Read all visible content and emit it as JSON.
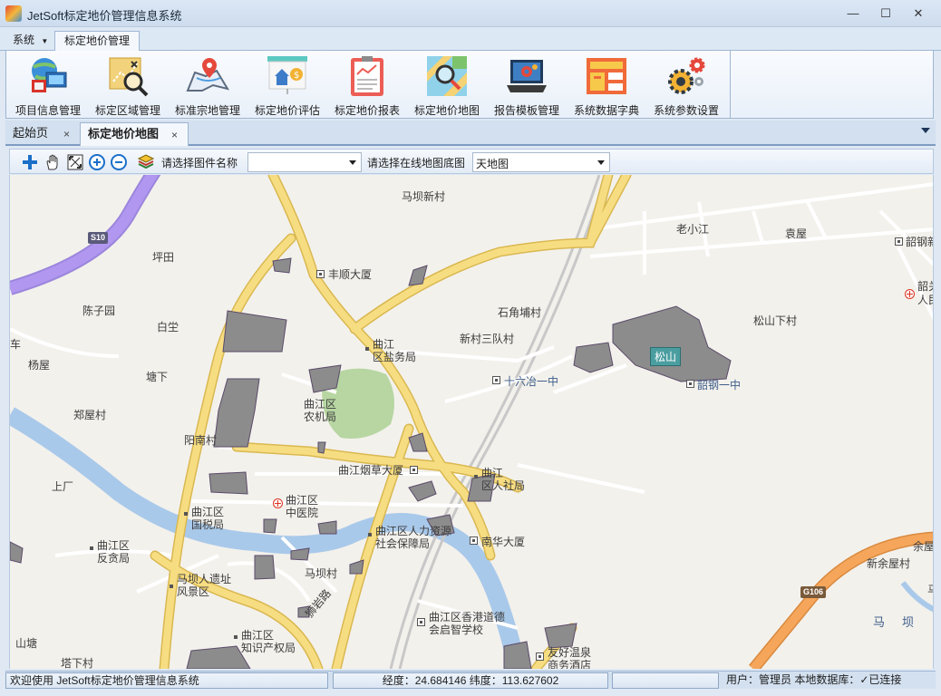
{
  "window": {
    "title": "JetSoft标定地价管理信息系统",
    "controls": [
      "—",
      "☐",
      "✕"
    ]
  },
  "ribbon": {
    "tabs": [
      {
        "label": "系统",
        "has_dropdown": true
      },
      {
        "label": "标定地价管理",
        "active": true
      }
    ],
    "buttons": [
      {
        "label": "项目信息管理",
        "icon": "globe-network-icon"
      },
      {
        "label": "标定区域管理",
        "icon": "map-search-icon"
      },
      {
        "label": "标准宗地管理",
        "icon": "map-pin-icon"
      },
      {
        "label": "标定地价评估",
        "icon": "house-price-icon"
      },
      {
        "label": "标定地价报表",
        "icon": "report-chart-icon"
      },
      {
        "label": "标定地价地图",
        "icon": "map-magnifier-icon"
      },
      {
        "label": "报告模板管理",
        "icon": "laptop-gear-icon"
      },
      {
        "label": "系统数据字典",
        "icon": "data-dictionary-icon"
      },
      {
        "label": "系统参数设置",
        "icon": "gears-icon"
      }
    ]
  },
  "doc_tabs": [
    {
      "label": "起始页",
      "close": "×"
    },
    {
      "label": "标定地价地图",
      "close": "×",
      "active": true
    }
  ],
  "map_toolbar": {
    "tools": [
      "zoom-in-icon",
      "pan-hand-icon",
      "full-extent-icon",
      "zoom-in-circle-icon",
      "zoom-out-circle-icon",
      "layers-icon"
    ],
    "layer_label": "请选择图件名称",
    "layer_value": "",
    "basemap_label": "请选择在线地图底图",
    "basemap_value": "天地图"
  },
  "map": {
    "labels": {
      "mabanxincun": "马坝新村",
      "laoxiaojiang": "老小江",
      "yuanwu": "袁屋",
      "shaogangxin": "韶钢新",
      "pingtian": "坪田",
      "fengshun": "丰顺大厦",
      "shaoguang": "韶关",
      "renyi": "人民",
      "chenziyuan": "陈子园",
      "baitang": "白坣",
      "shijiaopucun": "石角埔村",
      "songshanxiacun": "松山下村",
      "che": "车",
      "qujiang_yanwu": "曲江\n区盐务局",
      "xincunsandui": "新村三队村",
      "songshan": "松山",
      "yangwu": "杨屋",
      "tangxia": "塘下",
      "shiliuye": "十六冶一中",
      "shaogangyizhong": "韶钢一中",
      "qujiang_nongji": "曲江区\n农机局",
      "zhengwucun": "郑屋村",
      "yangnancun": "阳南村",
      "yancao": "曲江烟草大厦",
      "renshe": "曲江\n区人社局",
      "shangchang": "上厂",
      "zhongyiyuan": "曲江区\n中医院",
      "guoshui": "曲江区\n国税局",
      "renli": "曲江区人力资源\n社会保障局",
      "nanhua": "南华大厦",
      "fanzui": "曲江区\n反贪局",
      "yuwu": "余屋",
      "yuwucun": "新余屋村",
      "maba_ruins": "马坝人遗址\n风景区",
      "mabacun": "马坝村",
      "shandong": "山塘",
      "xiangang": "曲江区香港道德\n会启智学校",
      "zhishi": "曲江区\n知识产权局",
      "youhao": "友好温泉\n商务酒店",
      "taxia": "塔下村",
      "ma": "马",
      "ba": "坝",
      "road_name": "狮岩路"
    },
    "road_shields": [
      "S10",
      "G106"
    ]
  },
  "status": {
    "welcome": "欢迎使用 JetSoft标定地价管理信息系统",
    "longitude": "24.684146",
    "latitude": "113.627602",
    "coords_text": "经度：24.684146   纬度：113.627602",
    "user_text": "用户：管理员  本地数据库：✓已连接"
  },
  "colors": {
    "road_major": "#f7dd82",
    "road_major_border": "#d9b850",
    "road_minor": "#ffffff",
    "river": "#a9c9ea",
    "park": "#b7d6a2",
    "parcel": "#8c8c8c",
    "expressway": "#b197f0",
    "national_road": "#f5a65a"
  }
}
